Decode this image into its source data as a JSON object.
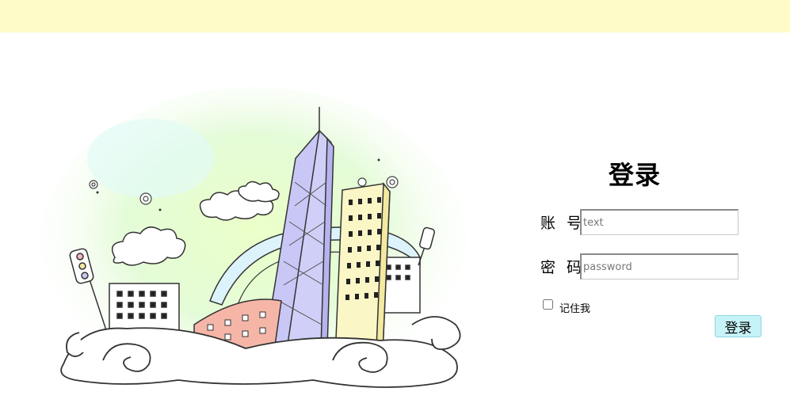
{
  "header": {
    "bar_color": "#fffbc8"
  },
  "illustration": {
    "icon": "city-buildings-illustration"
  },
  "login": {
    "title": "登录",
    "account_label": "账 号",
    "account_placeholder": "text",
    "account_value": "",
    "password_label": "密 码",
    "password_placeholder": "password",
    "password_value": "",
    "remember_label": "记住我",
    "remember_checked": false,
    "submit_label": "登录",
    "submit_color": "#c6f3f7"
  }
}
